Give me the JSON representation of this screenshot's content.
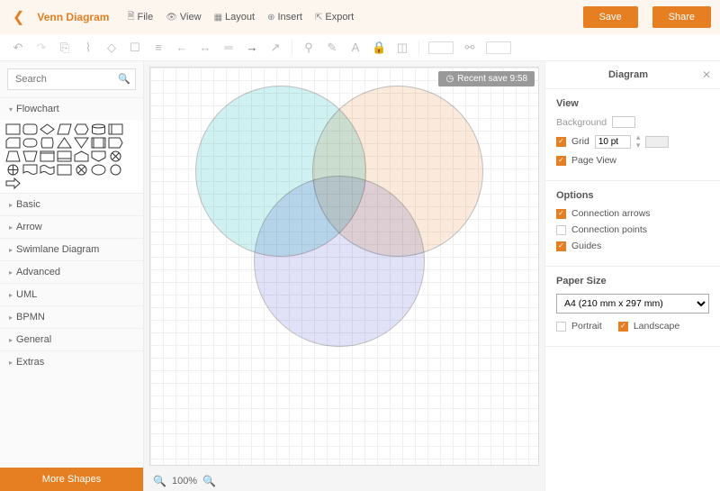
{
  "header": {
    "title": "Venn Diagram",
    "menu": {
      "file": "File",
      "view": "View",
      "layout": "Layout",
      "insert": "Insert",
      "export": "Export"
    },
    "save": "Save",
    "share": "Share"
  },
  "toolbar_icons": [
    "undo",
    "redo",
    "copy",
    "paste",
    "cut",
    "group",
    "align",
    "arrow-left",
    "arrow-both",
    "line",
    "arrow-right",
    "connector",
    "format-paint",
    "dropper",
    "text",
    "lock",
    "layer",
    "width",
    "link",
    "height"
  ],
  "sidebar": {
    "search_placeholder": "Search",
    "categories": [
      "Flowchart",
      "Basic",
      "Arrow",
      "Swimlane Diagram",
      "Advanced",
      "UML",
      "BPMN",
      "General",
      "Extras"
    ],
    "more": "More Shapes"
  },
  "canvas": {
    "recent_save": "Recent save 9:58",
    "zoom": "100%"
  },
  "rpanel": {
    "title": "Diagram",
    "view": {
      "heading": "View",
      "background": "Background",
      "grid": "Grid",
      "grid_value": "10 pt",
      "page_view": "Page View"
    },
    "options": {
      "heading": "Options",
      "conn_arrows": "Connection arrows",
      "conn_points": "Connection points",
      "guides": "Guides"
    },
    "paper": {
      "heading": "Paper Size",
      "select": "A4 (210 mm x 297 mm)",
      "portrait": "Portrait",
      "landscape": "Landscape"
    }
  }
}
